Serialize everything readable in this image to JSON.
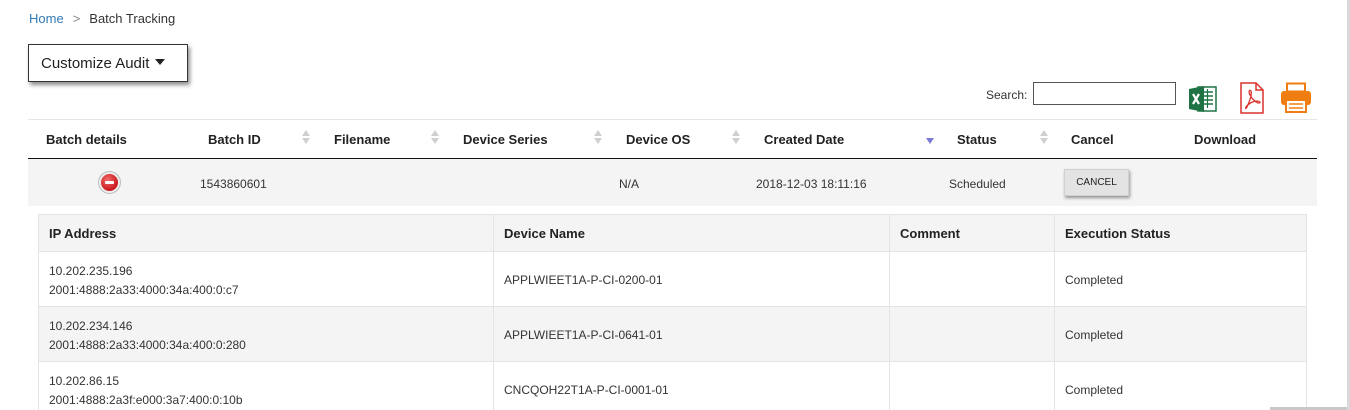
{
  "breadcrumb": {
    "home": "Home",
    "separator": ">",
    "current": "Batch Tracking"
  },
  "toolbar": {
    "customize_label": "Customize Audit",
    "search_label": "Search:",
    "search_value": ""
  },
  "export_icons": [
    "excel-icon",
    "pdf-icon",
    "print-icon"
  ],
  "colors": {
    "link": "#337ab7",
    "excel": "#1f7244",
    "pdf": "#d9332a",
    "print": "#f07d12",
    "remove": "#c9181e",
    "sort_active": "#7b7bd6"
  },
  "batch_table": {
    "columns": [
      "Batch details",
      "Batch ID",
      "Filename",
      "Device Series",
      "Device OS",
      "Created Date",
      "Status",
      "Cancel",
      "Download"
    ],
    "sorted_column": "Created Date",
    "rows": [
      {
        "batch_id": "1543860601",
        "filename": "",
        "device_series": "",
        "device_os": "N/A",
        "created_date": "2018-12-03 18:11:16",
        "status": "Scheduled",
        "cancel_label": "CANCEL"
      }
    ]
  },
  "detail_table": {
    "columns": [
      "IP Address",
      "Device Name",
      "Comment",
      "Execution Status"
    ],
    "rows": [
      {
        "ipv4": "10.202.235.196",
        "ipv6": "2001:4888:2a33:4000:34a:400:0:c7",
        "device_name": "APPLWIEET1A-P-CI-0200-01",
        "comment": "",
        "status": "Completed"
      },
      {
        "ipv4": "10.202.234.146",
        "ipv6": "2001:4888:2a33:4000:34a:400:0:280",
        "device_name": "APPLWIEET1A-P-CI-0641-01",
        "comment": "",
        "status": "Completed"
      },
      {
        "ipv4": "10.202.86.15",
        "ipv6": "2001:4888:2a3f:e000:3a7:400:0:10b",
        "device_name": "CNCQOH22T1A-P-CI-0001-01",
        "comment": "",
        "status": "Completed"
      }
    ]
  }
}
